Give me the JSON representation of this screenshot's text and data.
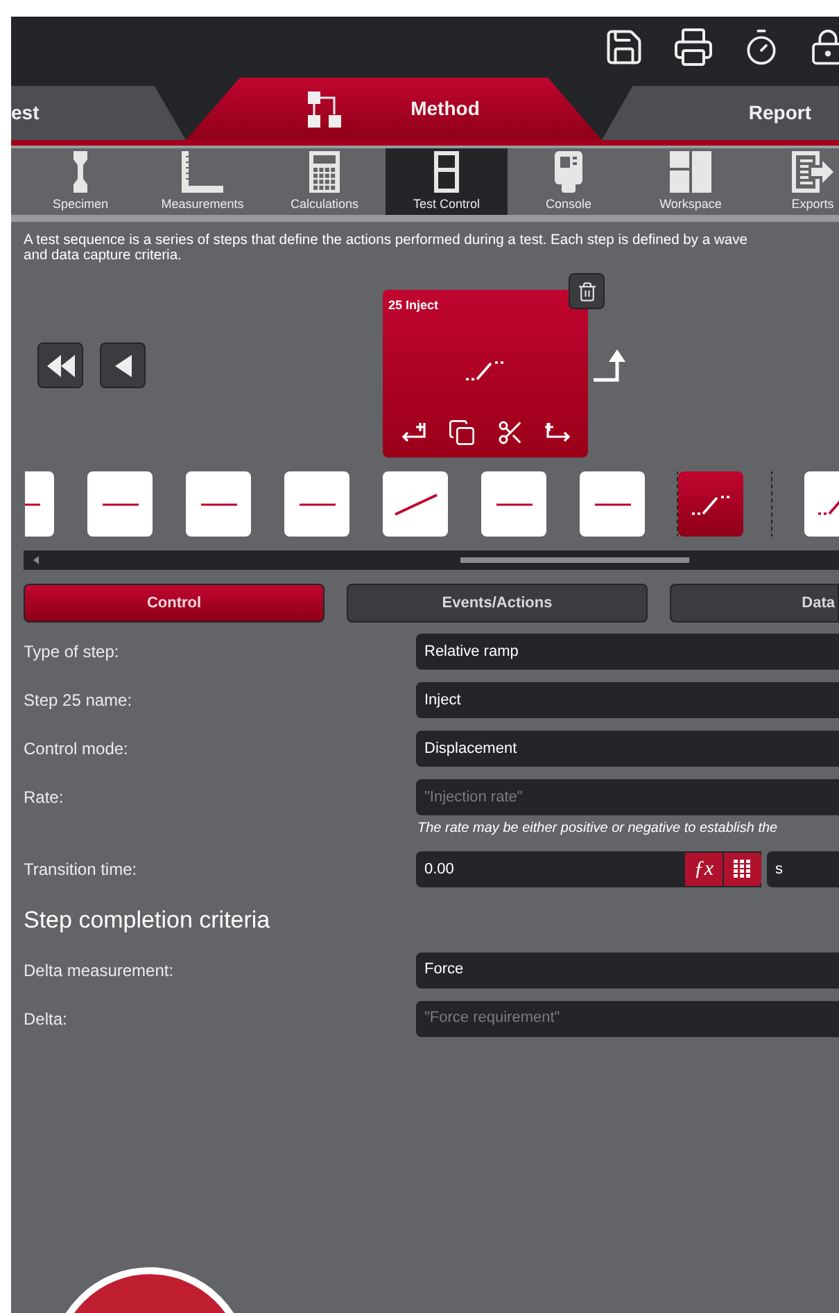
{
  "main_tabs": [
    {
      "label": "est",
      "selected": false
    },
    {
      "label": "Method",
      "selected": true
    },
    {
      "label": "Report",
      "selected": false
    }
  ],
  "sub_tabs": [
    {
      "label": "Specimen",
      "kind": "specimen",
      "selected": false
    },
    {
      "label": "Measurements",
      "kind": "measurements",
      "selected": false
    },
    {
      "label": "Calculations",
      "kind": "calculations",
      "selected": false
    },
    {
      "label": "Test Control",
      "kind": "control",
      "selected": true
    },
    {
      "label": "Console",
      "kind": "console",
      "selected": false
    },
    {
      "label": "Workspace",
      "kind": "workspace",
      "selected": false
    },
    {
      "label": "Exports",
      "kind": "exports",
      "selected": false
    }
  ],
  "description": [
    "A test sequence is a series of steps that define the actions performed during a test.  Each step is defined by a wave",
    "and data capture criteria."
  ],
  "step_card": {
    "title": "25 Inject"
  },
  "steps": [
    {
      "kind": "hold",
      "selected": false
    },
    {
      "kind": "hold",
      "selected": false
    },
    {
      "kind": "hold",
      "selected": false
    },
    {
      "kind": "hold",
      "selected": false
    },
    {
      "kind": "ramp",
      "selected": false
    },
    {
      "kind": "hold",
      "selected": false
    },
    {
      "kind": "hold",
      "selected": false
    },
    {
      "kind": "relative_ramp",
      "selected": true
    },
    {
      "kind": "relative_ramp",
      "selected": false
    }
  ],
  "section_tabs": [
    {
      "label": "Control",
      "selected": true
    },
    {
      "label": "Events/Actions",
      "selected": false
    },
    {
      "label": "Data",
      "selected": false
    }
  ],
  "fields": [
    {
      "label": "Type of step:",
      "value": "Relative ramp"
    },
    {
      "label": "Step 25 name:",
      "value": "Inject"
    },
    {
      "label": "Control mode:",
      "value": "Displacement"
    },
    {
      "label": "Rate:",
      "placeholder": "\"Injection rate\"",
      "hint": "The rate may be either positive or negative to establish the"
    },
    {
      "label": "Transition time:",
      "value": "0.00",
      "formula": "ƒx",
      "unit": "s"
    }
  ],
  "completion": {
    "heading": "Step completion criteria",
    "fields": [
      {
        "label": "Delta measurement:",
        "value": "Force"
      },
      {
        "label": "Delta:",
        "placeholder": "\"Force requirement\""
      }
    ]
  }
}
